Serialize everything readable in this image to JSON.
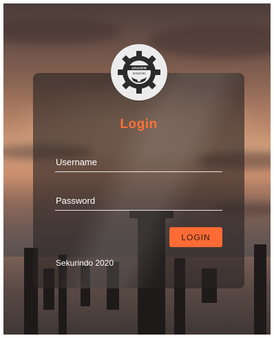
{
  "logo": {
    "icon": "gear-camera-logo-icon",
    "text_top": "ARAIVEIR",
    "text_bottom": "Sekurindo"
  },
  "form": {
    "title": "Login",
    "username_placeholder": "Username",
    "password_placeholder": "Password",
    "submit_label": "LOGIN"
  },
  "footer": {
    "copyright": "Sekurindo 2020"
  },
  "colors": {
    "accent": "#ff6b35",
    "title": "#ff7136",
    "card": "rgba(40,35,35,0.62)"
  }
}
